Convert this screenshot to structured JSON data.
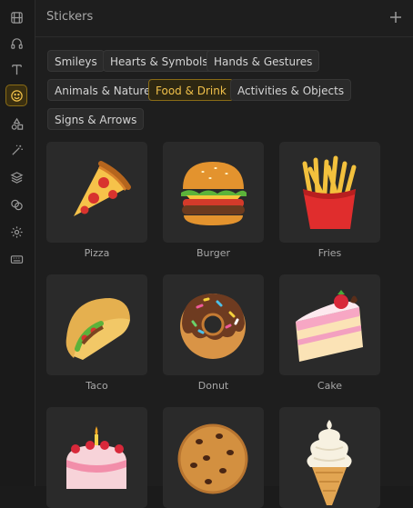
{
  "panel": {
    "title": "Stickers"
  },
  "categories": [
    {
      "label": "Smileys"
    },
    {
      "label": "Hearts & Symbols"
    },
    {
      "label": "Hands & Gestures"
    },
    {
      "label": "Animals & Nature"
    },
    {
      "label": "Food & Drink",
      "active": true
    },
    {
      "label": "Activities & Objects"
    },
    {
      "label": "Signs & Arrows"
    }
  ],
  "stickers": [
    {
      "label": "Pizza"
    },
    {
      "label": "Burger"
    },
    {
      "label": "Fries"
    },
    {
      "label": "Taco"
    },
    {
      "label": "Donut"
    },
    {
      "label": "Cake"
    },
    {
      "label": ""
    },
    {
      "label": ""
    },
    {
      "label": ""
    }
  ],
  "rail": [
    "film-icon",
    "headphones-icon",
    "text-icon",
    "smiley-icon",
    "shapes-icon",
    "magic-wand-icon",
    "layers-icon",
    "blend-icon",
    "settings-icon",
    "keyboard-icon"
  ],
  "colors": {
    "accent": "#f0c04a",
    "accent_bg": "#2d2712"
  }
}
